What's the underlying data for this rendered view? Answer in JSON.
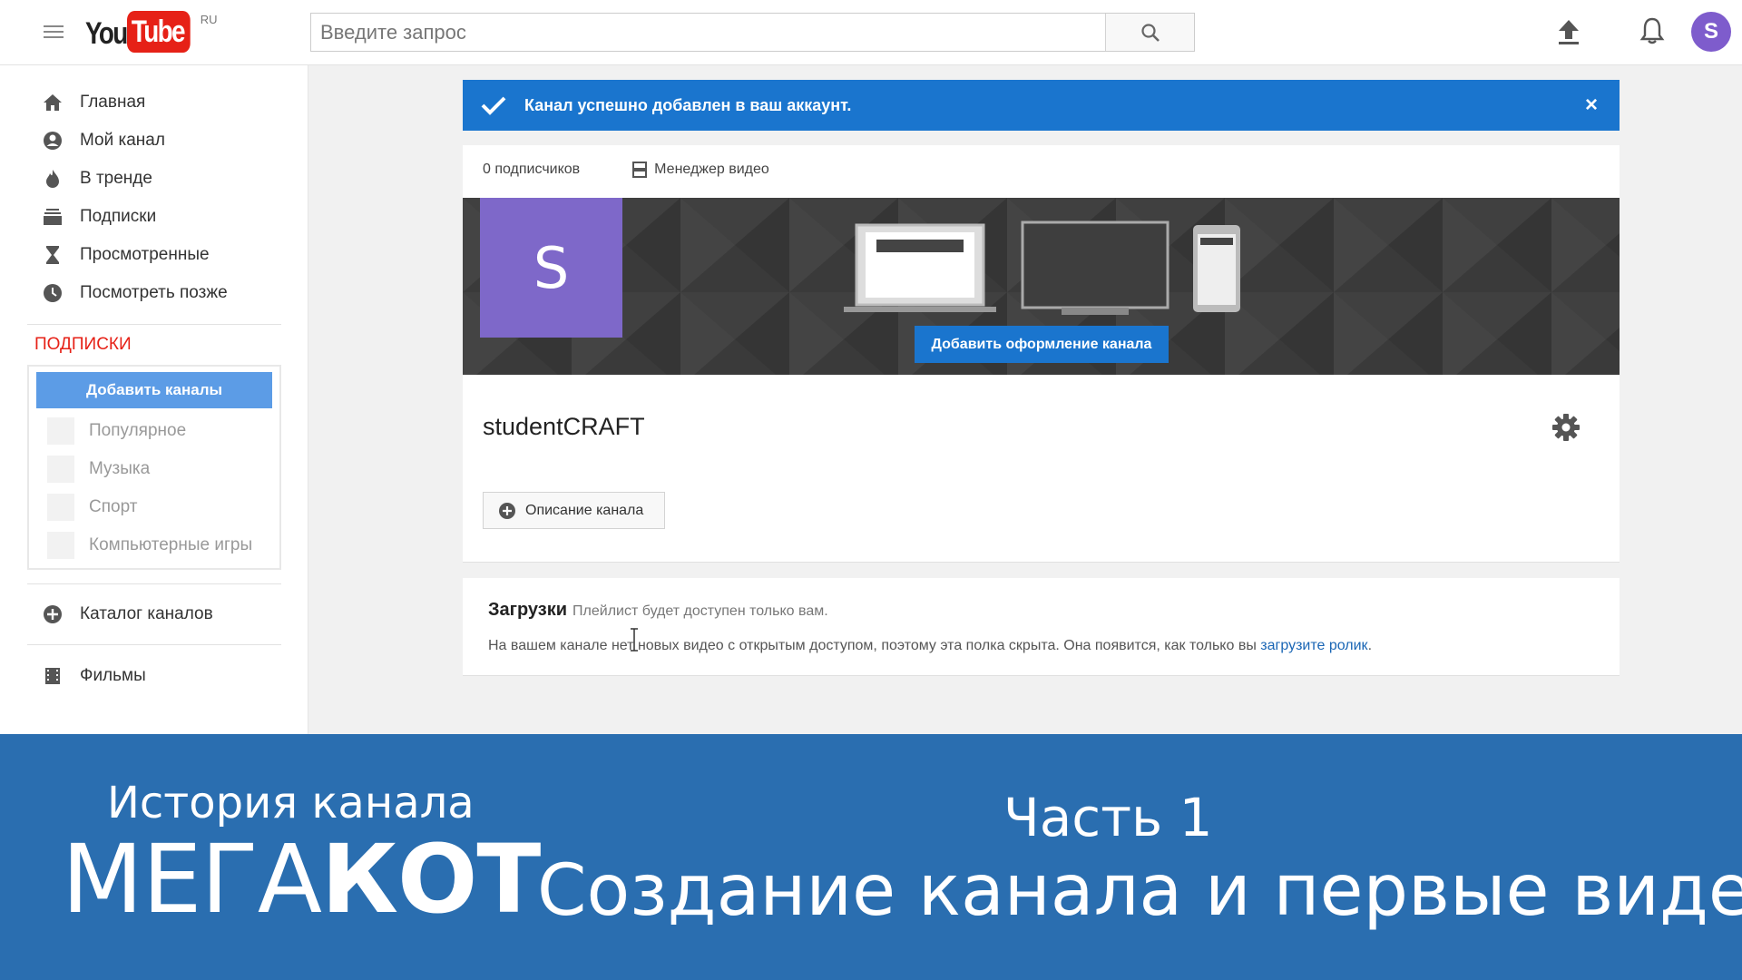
{
  "header": {
    "logo_you": "You",
    "logo_tube": "Tube",
    "logo_region": "RU",
    "search_placeholder": "Введите запрос",
    "avatar_letter": "S"
  },
  "sidebar": {
    "nav": [
      {
        "label": "Главная",
        "icon": "home-icon"
      },
      {
        "label": "Мой канал",
        "icon": "user-circle-icon"
      },
      {
        "label": "В тренде",
        "icon": "flame-icon"
      },
      {
        "label": "Подписки",
        "icon": "subscriptions-icon"
      },
      {
        "label": "Просмотренные",
        "icon": "hourglass-icon"
      },
      {
        "label": "Посмотреть позже",
        "icon": "clock-icon"
      }
    ],
    "subscriptions_heading": "ПОДПИСКИ",
    "add_channels_label": "Добавить каналы",
    "subscriptions": [
      "Популярное",
      "Музыка",
      "Спорт",
      "Компьютерные игры"
    ],
    "catalog_label": "Каталог каналов",
    "movies_label": "Фильмы"
  },
  "notice": {
    "message": "Канал успешно добавлен в ваш аккаунт.",
    "close": "×"
  },
  "channel": {
    "subscribers": "0 подписчиков",
    "video_manager": "Менеджер видео",
    "avatar_letter": "S",
    "add_art_label": "Добавить оформление канала",
    "name": "studentCRAFT",
    "description_button": "Описание канала"
  },
  "uploads": {
    "title": "Загрузки",
    "subtitle": "Плейлист будет доступен только вам.",
    "text": "На вашем канале нет новых видео с открытым доступом, поэтому эта полка скрыта. Она появится, как только вы ",
    "link": "загрузите ролик",
    "text_end": "."
  },
  "caption": {
    "series": "История канала",
    "brand_light": "МЕГА",
    "brand_bold": "КОТ",
    "part": "Часть 1",
    "title": "Создание канала и первые видео"
  },
  "colors": {
    "brand_red": "#e62117",
    "blue": "#1a75ce",
    "avatar_purple": "#7e68c9",
    "caption_blue": "#2a6eb0"
  }
}
